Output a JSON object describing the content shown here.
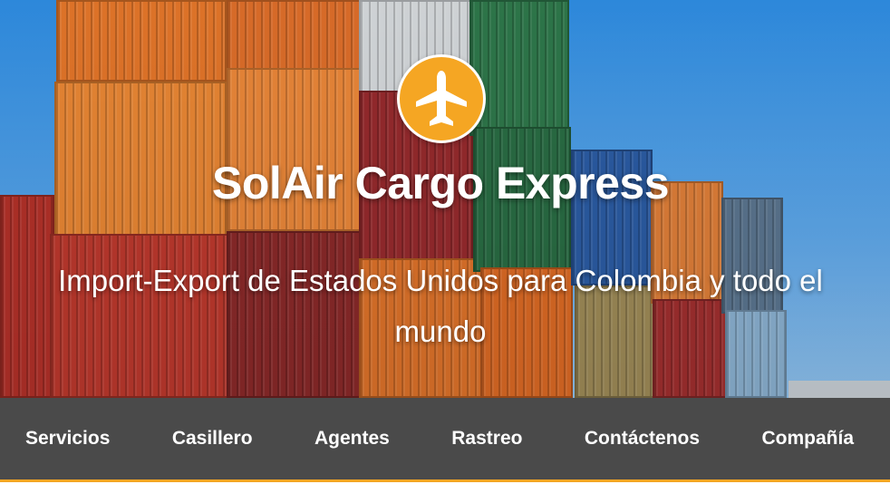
{
  "hero": {
    "title": "SolAir Cargo Express",
    "subtitle": "Import-Export de Estados Unidos para Colombia y todo el mundo",
    "logo_icon": "airplane-icon",
    "accent_color": "#f5a623"
  },
  "nav": {
    "items": [
      {
        "label": "Servicios"
      },
      {
        "label": "Casillero"
      },
      {
        "label": "Agentes"
      },
      {
        "label": "Rastreo"
      },
      {
        "label": "Contáctenos"
      },
      {
        "label": "Compañía"
      }
    ],
    "background_color": "#4a4a4a",
    "accent_color": "#f5a623"
  }
}
